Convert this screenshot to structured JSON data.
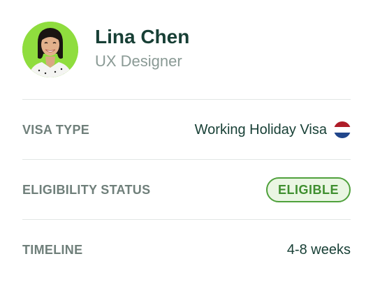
{
  "profile": {
    "name": "Lina Chen",
    "role": "UX Designer",
    "avatar_bg": "#8fdd3e"
  },
  "details": [
    {
      "label": "VISA TYPE",
      "value": "Working Holiday Visa",
      "icon": "netherlands-flag-icon"
    },
    {
      "label": "ELIGIBILITY STATUS",
      "value": "ELIGIBLE",
      "style": "badge",
      "badge_color": "#4fa13c"
    },
    {
      "label": "TIMELINE",
      "value": "4-8 weeks"
    }
  ]
}
